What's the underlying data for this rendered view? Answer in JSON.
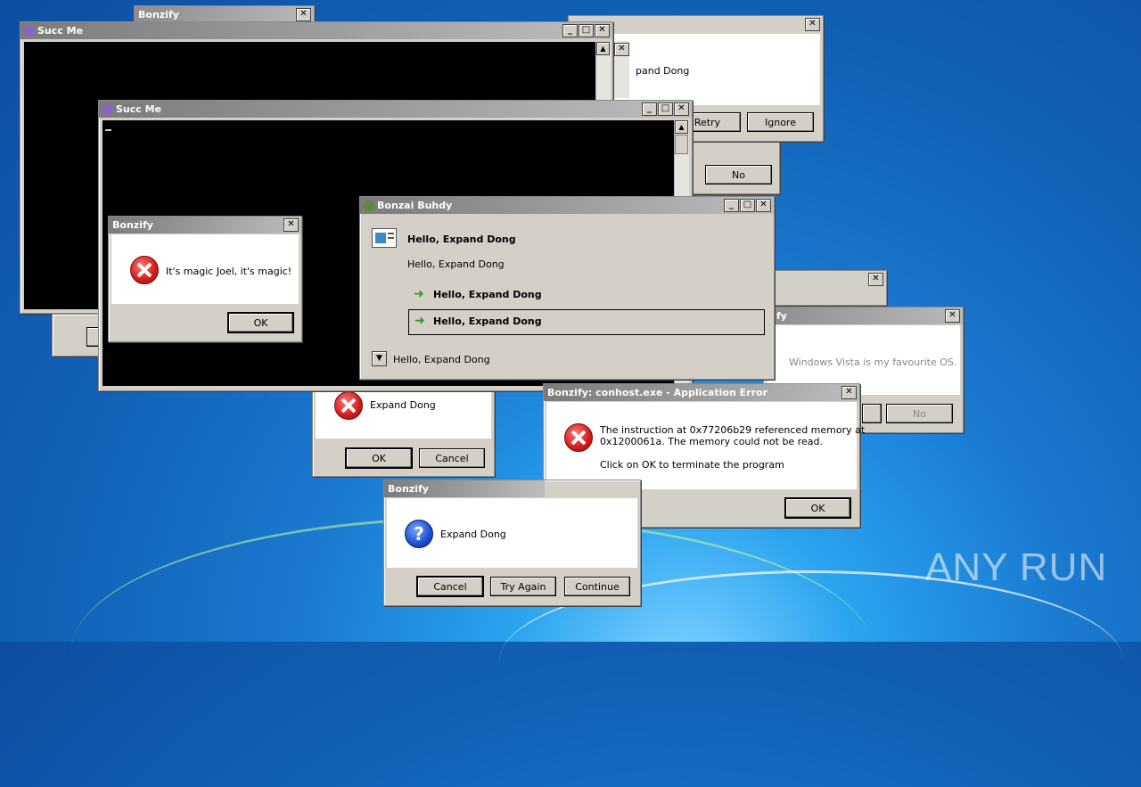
{
  "windows": {
    "bonzify_top": {
      "title": "Bonzify"
    },
    "retry_dialog": {
      "text": "pand Dong",
      "retry": "Retry",
      "ignore": "Ignore"
    },
    "no_dialog": {
      "no": "No"
    },
    "succ1": {
      "title": "Succ Me"
    },
    "succ2": {
      "title": "Succ Me"
    },
    "magic": {
      "title": "Bonzify",
      "text": "It's magic Joel, it's magic!",
      "ok": "OK"
    },
    "buhdy": {
      "title": "Bonzai Buhdy",
      "heading": "Hello, Expand Dong",
      "body": "Hello, Expand Dong",
      "link1": "Hello, Expand Dong",
      "link2": "Hello, Expand Dong",
      "expander": "Hello, Expand Dong"
    },
    "vista": {
      "title": "fy",
      "text": "Windows Vista is my favourite OS.",
      "no": "No"
    },
    "expand_err": {
      "text": "Expand Dong",
      "ok": "OK",
      "cancel": "Cancel"
    },
    "apperr": {
      "title": "Bonzify: conhost.exe - Application Error",
      "line1": "The instruction at 0x77206b29 referenced memory at",
      "line2": "0x1200061a. The memory could not be read.",
      "line3": "Click on OK to terminate the program",
      "ok": "OK"
    },
    "question": {
      "title": "Bonzify",
      "text": "Expand Dong",
      "cancel": "Cancel",
      "try_again": "Try Again",
      "continue": "Continue"
    }
  },
  "watermark": "ANY RUN"
}
